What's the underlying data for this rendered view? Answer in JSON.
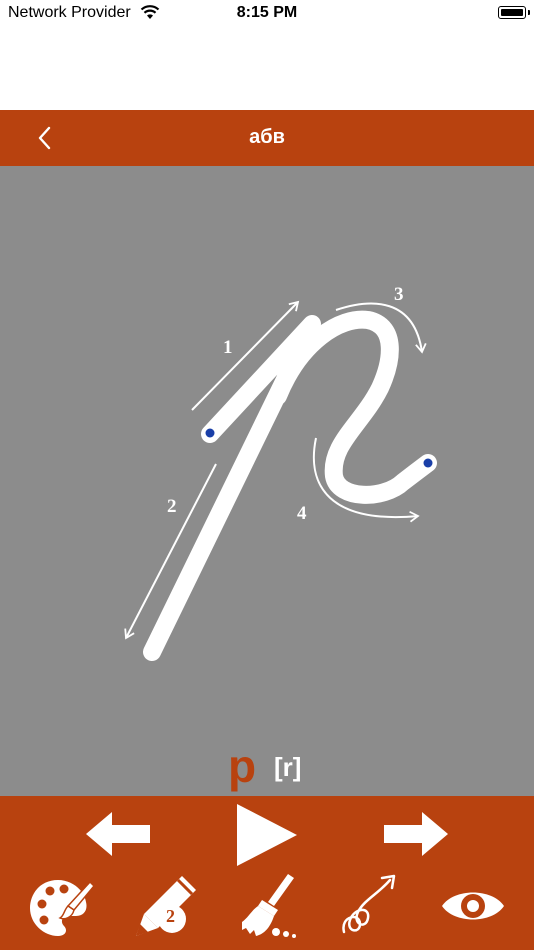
{
  "status_bar": {
    "carrier": "Network Provider",
    "time": "8:15 PM"
  },
  "nav": {
    "title": "абв",
    "back_icon": "chevron-left-icon"
  },
  "tracing": {
    "letter": "р",
    "transliteration": "[r]",
    "stroke_numbers": [
      "1",
      "2",
      "3",
      "4"
    ]
  },
  "toolbar": {
    "prev_icon": "arrow-left-icon",
    "play_icon": "play-icon",
    "next_icon": "arrow-right-icon",
    "palette_icon": "palette-icon",
    "pen_icon": "pencil-icon",
    "pen_size": "2",
    "clear_icon": "broom-icon",
    "animate_icon": "loop-arrow-icon",
    "show_icon": "eye-icon"
  },
  "colors": {
    "accent": "#b8420f",
    "canvas": "#8c8c8c",
    "dot": "#1a3fa8"
  }
}
